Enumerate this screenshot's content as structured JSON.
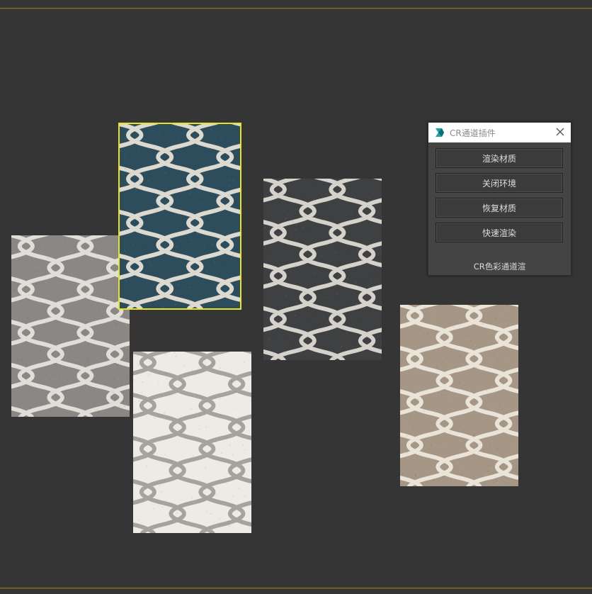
{
  "plugin_panel": {
    "title": "CR通道插件",
    "buttons": [
      {
        "label": "渲染材质"
      },
      {
        "label": "关闭环境"
      },
      {
        "label": "恢复材质"
      },
      {
        "label": "快速渲染"
      }
    ],
    "footer": "CR色彩通道渲"
  },
  "viewport": {
    "background_color": "#353535",
    "selection_color": "#e8e22a",
    "rugs": [
      {
        "id": "grey-rug",
        "base": "#8b8784",
        "line": "#e8e4df"
      },
      {
        "id": "blue-rug",
        "base": "#2e4d5c",
        "line": "#ece6da",
        "selected": true
      },
      {
        "id": "charcoal-rug",
        "base": "#3f4041",
        "line": "#e2ded8"
      },
      {
        "id": "white-rug",
        "base": "#eeebe6",
        "line": "#a09c98"
      },
      {
        "id": "beige-rug",
        "base": "#a69685",
        "line": "#f0e9e0"
      }
    ]
  }
}
